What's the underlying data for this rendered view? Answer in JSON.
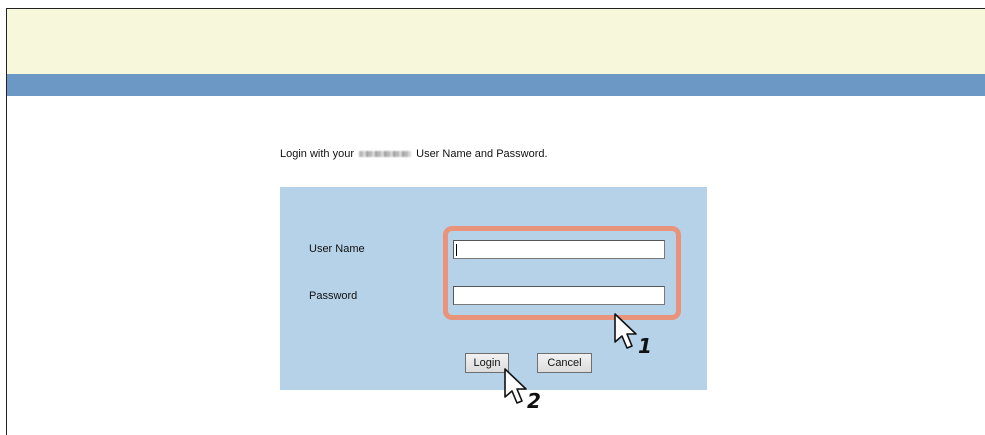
{
  "instruction": {
    "prefix": "Login with your",
    "suffix": "User Name and Password."
  },
  "form": {
    "username_label": "User Name",
    "username_value": "",
    "password_label": "Password",
    "password_value": ""
  },
  "buttons": {
    "login": "Login",
    "cancel": "Cancel"
  },
  "steps": {
    "one": "1",
    "two": "2"
  },
  "colors": {
    "banner": "#f7f7dc",
    "bar": "#6b98c5",
    "panel": "#b5d2e8",
    "highlight": "#e8937a"
  }
}
